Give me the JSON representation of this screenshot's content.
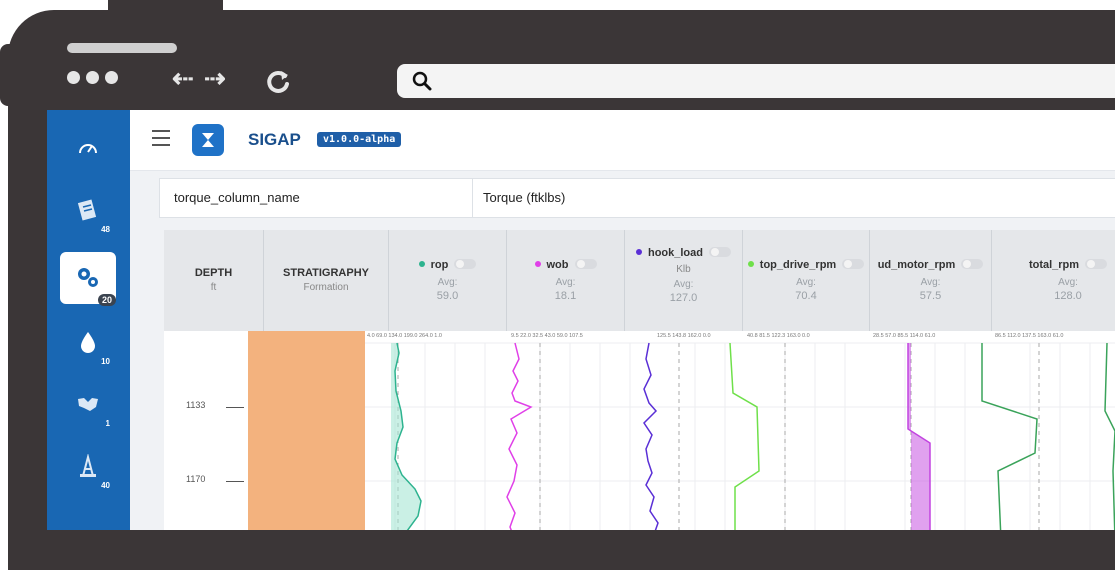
{
  "browser": {
    "search_icon": "search-icon",
    "nav_back": "⇠",
    "nav_forward": "⇢",
    "reload_icon": "reload-icon"
  },
  "sidebar": {
    "items": [
      {
        "icon": "gauge-icon",
        "badge": ""
      },
      {
        "icon": "document-icon",
        "badge": "48"
      },
      {
        "icon": "gears-icon",
        "badge": "20",
        "active": true
      },
      {
        "icon": "drop-icon",
        "badge": "10"
      },
      {
        "icon": "handshake-icon",
        "badge": "1"
      },
      {
        "icon": "oil-rig-icon",
        "badge": "40"
      }
    ]
  },
  "header": {
    "app_name": "SIGAP",
    "version": "v1.0.0-alpha"
  },
  "param": {
    "key": "torque_column_name",
    "value": "Torque (ftklbs)"
  },
  "log": {
    "depth_header": "DEPTH",
    "depth_unit": "ft",
    "strat_header": "STRATIGRAPHY",
    "strat_sub": "Formation",
    "depth_ticks": [
      "1133",
      "1170"
    ],
    "channels": [
      {
        "name": "rop",
        "color": "#2db38f",
        "unit": "",
        "avg_label": "Avg:",
        "avg": "59.0",
        "scale": "4.0   69.0  134.0  199.0  264.0  1.0"
      },
      {
        "name": "wob",
        "color": "#e040e8",
        "unit": "",
        "avg_label": "Avg:",
        "avg": "18.1",
        "scale": "9.5   22.0   32.5   43.0  59.0  107.5"
      },
      {
        "name": "hook_load",
        "color": "#5a2fd6",
        "unit": "Klb",
        "avg_label": "Avg:",
        "avg": "127.0",
        "scale": "125.5  143.8  162.0  0.0"
      },
      {
        "name": "top_drive_rpm",
        "color": "#6fe04a",
        "unit": "",
        "avg_label": "Avg:",
        "avg": "70.4",
        "scale": "40.8   81.5  122.3  163.0  0.0"
      },
      {
        "name": "ud_motor_rpm",
        "color": "#c244e0",
        "unit": "",
        "avg_label": "Avg:",
        "avg": "57.5",
        "scale": "28.5  57.0  85.5  114.0  61.0"
      },
      {
        "name": "total_rpm",
        "color": "#3aa35a",
        "unit": "",
        "avg_label": "Avg:",
        "avg": "128.0",
        "scale": "86.5  112.0  137.5  163.0  61.0"
      }
    ]
  }
}
